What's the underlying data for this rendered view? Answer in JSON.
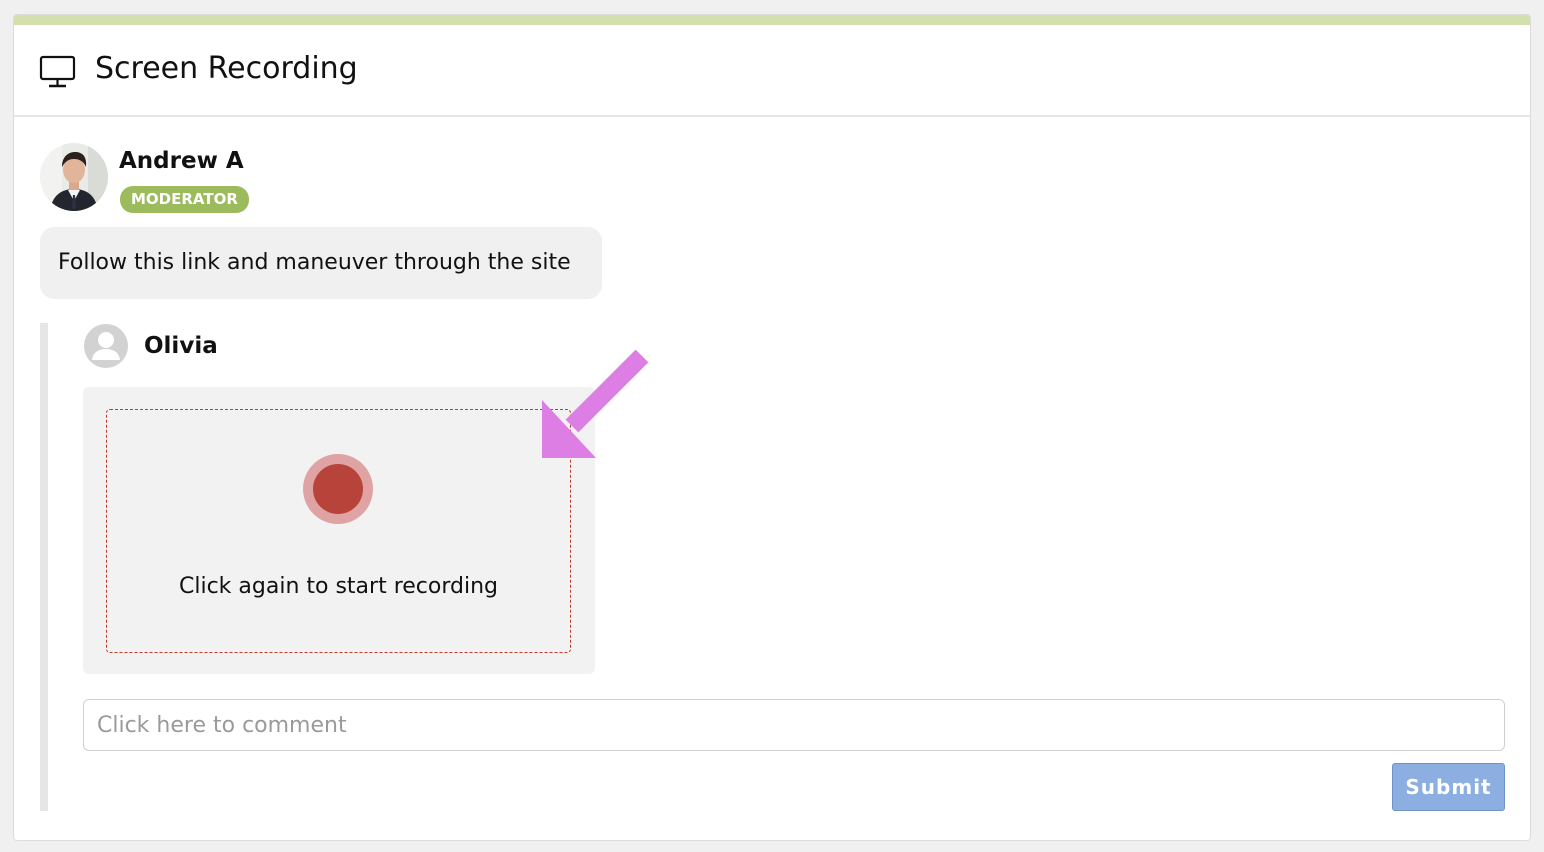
{
  "header": {
    "icon": "monitor-icon",
    "title": "Screen Recording",
    "accent_color": "#d3e0ad"
  },
  "moderator_post": {
    "author_name": "Andrew A",
    "role_badge": "MODERATOR",
    "badge_color": "#9cbb5d",
    "message": "Follow this link and maneuver through the site"
  },
  "reply": {
    "author_name": "Olivia",
    "avatar_icon": "user-placeholder-icon",
    "recorder": {
      "hint": "Click again to start recording",
      "button_icon": "record-icon",
      "record_color": "#b8433a"
    }
  },
  "annotation": {
    "icon": "pointer-arrow-icon",
    "color": "#dd7ee4"
  },
  "comment": {
    "placeholder": "Click here to comment",
    "value": "",
    "submit_label": "Submit"
  }
}
